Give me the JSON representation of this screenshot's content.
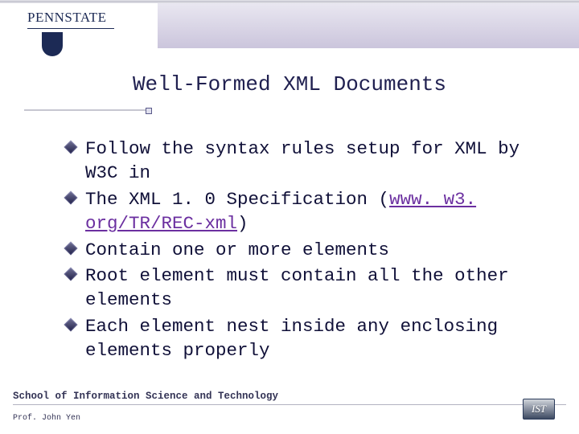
{
  "logo": {
    "word": "PENNSTATE",
    "shield_text": ""
  },
  "title": "Well-Formed XML Documents",
  "bullets": [
    {
      "text_before": "Follow the syntax rules setup for XML by W3C in",
      "link_text": "",
      "text_after": ""
    },
    {
      "text_before": "The XML 1. 0 Specification (",
      "link_text": "www. w3. org/TR/REC-xml",
      "text_after": ")"
    },
    {
      "text_before": "Contain one or more elements",
      "link_text": "",
      "text_after": ""
    },
    {
      "text_before": "Root element must contain all the other elements",
      "link_text": "",
      "text_after": ""
    },
    {
      "text_before": "Each element nest inside any enclosing elements properly",
      "link_text": "",
      "text_after": ""
    }
  ],
  "footer": {
    "dept": "School of Information Science and Technology",
    "prof": "Prof. John Yen",
    "ist": "IST"
  }
}
